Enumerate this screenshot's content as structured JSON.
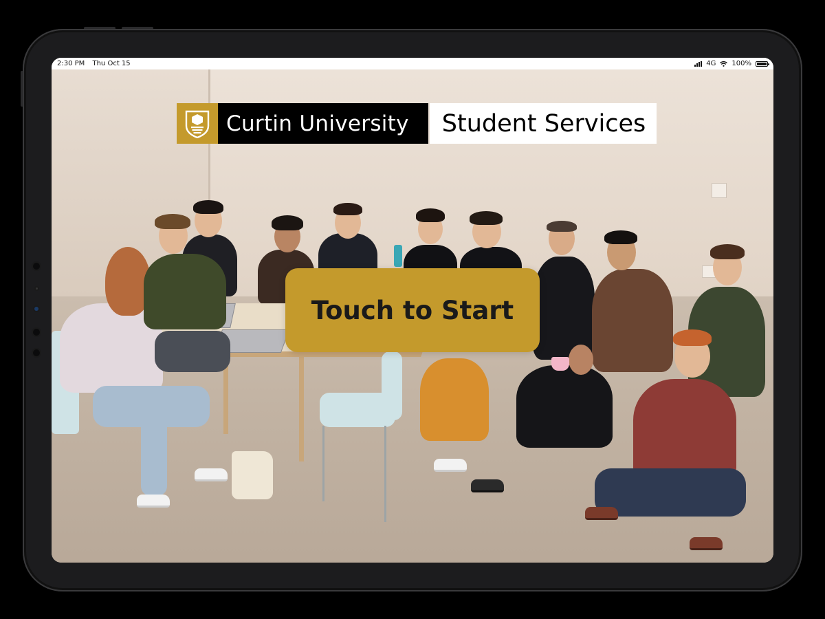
{
  "status_bar": {
    "time": "2:30 PM",
    "date": "Thu Oct 15",
    "network": "4G",
    "battery": "100%",
    "battery_level": 1.0
  },
  "header": {
    "university_name": "Curtin University",
    "service_name": "Student Services",
    "logo_icon": "curtin-crest-icon",
    "brand_color": "#c49a2c"
  },
  "main": {
    "start_button_label": "Touch to Start",
    "background_image": "group-photo-students"
  },
  "colors": {
    "accent": "#c49a2c",
    "frame": "#1c1c1e",
    "banner_dark": "#000000",
    "banner_light": "#ffffff"
  }
}
